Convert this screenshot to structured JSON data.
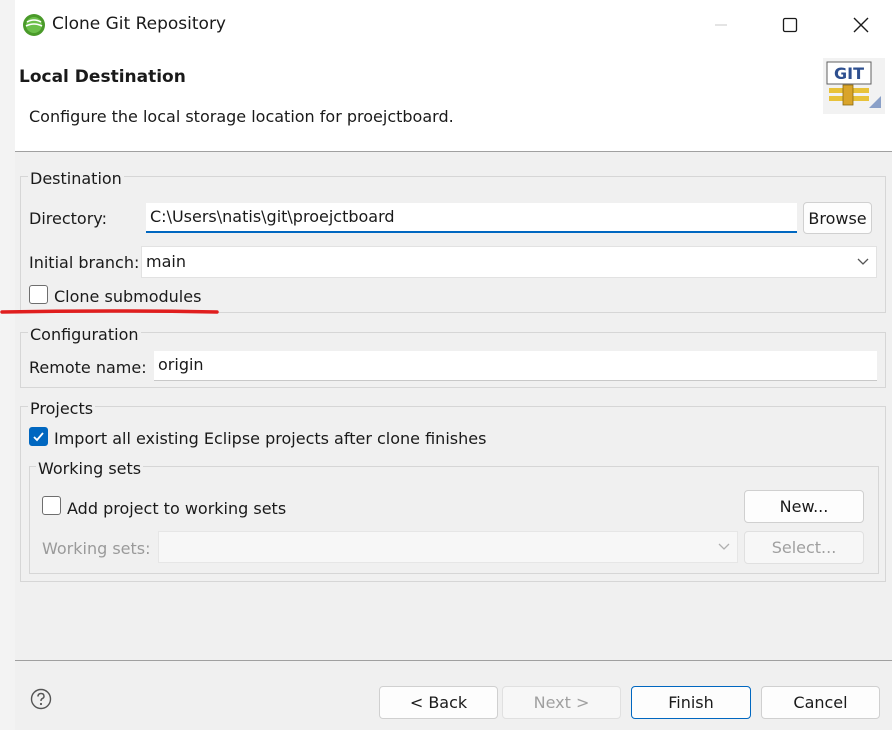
{
  "window": {
    "title": "Clone Git Repository",
    "app_icon": "eclipse-icon",
    "controls": [
      "minimize-icon",
      "maximize-icon",
      "close-icon"
    ]
  },
  "banner": {
    "title": "Local Destination",
    "description": "Configure the local storage location for proejctboard.",
    "logo_text": "GIT"
  },
  "destination": {
    "group_label": "Destination",
    "directory_label": "Directory:",
    "directory_value": "C:\\Users\\natis\\git\\proejctboard",
    "browse_label": "Browse",
    "branch_label": "Initial branch:",
    "branch_value": "main",
    "clone_submodules_label": "Clone submodules",
    "clone_submodules_checked": false
  },
  "configuration": {
    "group_label": "Configuration",
    "remote_label": "Remote name:",
    "remote_value": "origin"
  },
  "projects": {
    "group_label": "Projects",
    "import_label": "Import all existing Eclipse projects after clone finishes",
    "import_checked": true,
    "working_sets": {
      "group_label": "Working sets",
      "add_label": "Add project to working sets",
      "add_checked": false,
      "new_label": "New...",
      "sets_label": "Working sets:",
      "select_label": "Select..."
    }
  },
  "footer": {
    "help_icon": "help-icon",
    "back_label": "< Back",
    "next_label": "Next >",
    "finish_label": "Finish",
    "cancel_label": "Cancel"
  },
  "colors": {
    "accent": "#0067c0",
    "annotation": "#e01e1e"
  }
}
